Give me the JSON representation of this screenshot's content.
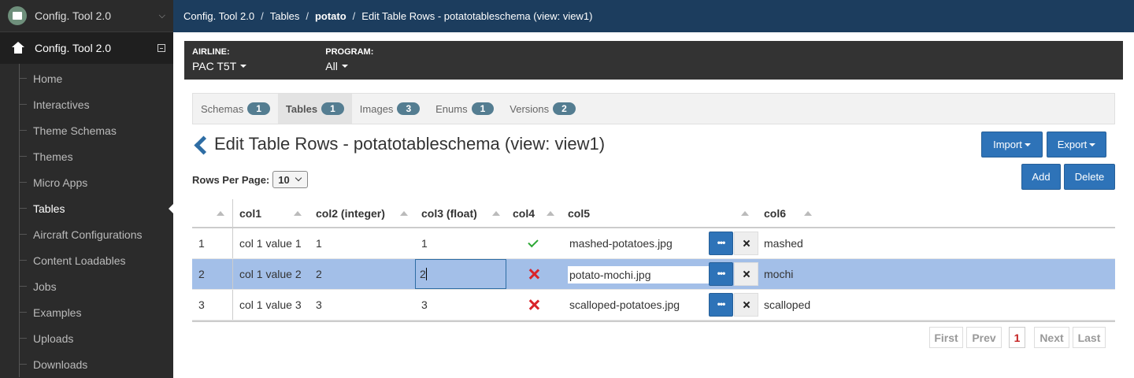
{
  "sidebar": {
    "top_title": "Config. Tool 2.0",
    "app_title": "Config. Tool 2.0",
    "items": [
      {
        "label": "Home"
      },
      {
        "label": "Interactives"
      },
      {
        "label": "Theme Schemas"
      },
      {
        "label": "Themes"
      },
      {
        "label": "Micro Apps"
      },
      {
        "label": "Tables"
      },
      {
        "label": "Aircraft Configurations"
      },
      {
        "label": "Content Loadables"
      },
      {
        "label": "Jobs"
      },
      {
        "label": "Examples"
      },
      {
        "label": "Uploads"
      },
      {
        "label": "Downloads"
      }
    ],
    "active": "Tables"
  },
  "breadcrumb": [
    "Config. Tool 2.0",
    "Tables",
    "potato",
    "Edit Table Rows - potatotableschema (view: view1)"
  ],
  "filters": {
    "airline": {
      "label": "AIRLINE:",
      "value": "PAC T5T"
    },
    "program": {
      "label": "PROGRAM:",
      "value": "All"
    }
  },
  "tabs": [
    {
      "label": "Schemas",
      "count": "1"
    },
    {
      "label": "Tables",
      "count": "1"
    },
    {
      "label": "Images",
      "count": "3"
    },
    {
      "label": "Enums",
      "count": "1"
    },
    {
      "label": "Versions",
      "count": "2"
    }
  ],
  "active_tab": "Tables",
  "page_title": "Edit Table Rows - potatotableschema (view: view1)",
  "buttons": {
    "import": "Import",
    "export": "Export",
    "add": "Add",
    "delete": "Delete"
  },
  "rows_per_page": {
    "label": "Rows Per Page:",
    "value": "10"
  },
  "table": {
    "columns": [
      "col1",
      "col2 (integer)",
      "col3 (float)",
      "col4",
      "col5",
      "col6"
    ],
    "rows": [
      {
        "index": "1",
        "col1": "col 1 value 1",
        "col2": "1",
        "col3": "1",
        "col4": true,
        "col5": "mashed-potatoes.jpg",
        "col6": "mashed",
        "selected": false
      },
      {
        "index": "2",
        "col1": "col 1 value 2",
        "col2": "2",
        "col3": "2",
        "col4": false,
        "col5": "potato-mochi.jpg",
        "col6": "mochi",
        "selected": true
      },
      {
        "index": "3",
        "col1": "col 1 value 3",
        "col2": "3",
        "col3": "3",
        "col4": false,
        "col5": "scalloped-potatoes.jpg",
        "col6": "scalloped",
        "selected": false
      }
    ]
  },
  "pagination": {
    "first": "First",
    "prev": "Prev",
    "current": "1",
    "next": "Next",
    "last": "Last"
  },
  "colors": {
    "topbar": "#1c3d5e",
    "accent": "#2e73b8",
    "selected_row": "#a3bfe8",
    "badge": "#547d91",
    "check": "#2ea836",
    "cross": "#d9242a"
  }
}
